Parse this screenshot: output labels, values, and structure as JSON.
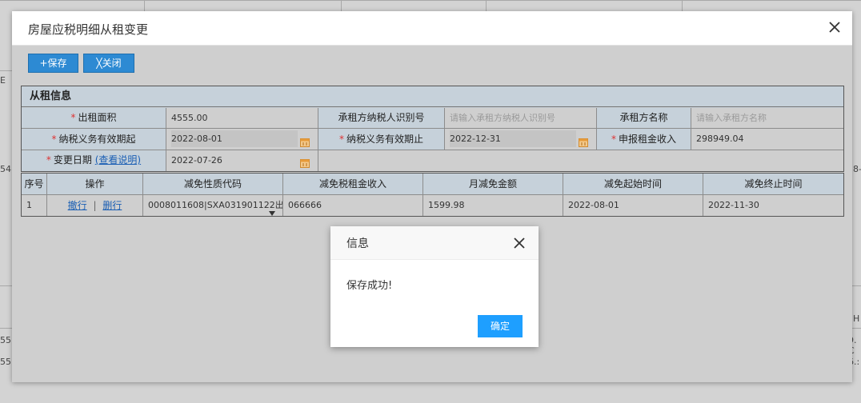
{
  "dialog": {
    "title": "房屋应税明细从租变更",
    "save_label": "+保存",
    "close_label": "╳关闭"
  },
  "section": {
    "title": "从租信息"
  },
  "form": {
    "rent_area_label": "出租面积",
    "rent_area_value": "4555.00",
    "lessee_taxid_label": "承租方纳税人识别号",
    "lessee_taxid_placeholder": "请输入承租方纳税人识别号",
    "lessee_name_label": "承租方名称",
    "lessee_name_placeholder": "请输入承租方名称",
    "tax_start_label": "纳税义务有效期起",
    "tax_start_value": "2022-08-01",
    "tax_end_label": "纳税义务有效期止",
    "tax_end_value": "2022-12-31",
    "rent_income_label": "申报租金收入",
    "rent_income_value": "298949.04",
    "change_date_label": "变更日期",
    "change_date_link": "(查看说明)",
    "change_date_value": "2022-07-26",
    "required_mark": "*"
  },
  "grid": {
    "headers": [
      "序号",
      "操作",
      "减免性质代码",
      "减免税租金收入",
      "月减免金额",
      "减免起始时间",
      "减免终止时间"
    ],
    "rows": [
      {
        "index": "1",
        "undo": "撤行",
        "sep": "|",
        "delete": "删行",
        "code": "0008011608|SXA031901122出",
        "income": "066666",
        "monthly": "1599.98",
        "start": "2022-08-01",
        "end": "2022-11-30"
      }
    ]
  },
  "message": {
    "title": "信息",
    "text": "保存成功!",
    "ok_label": "确定"
  },
  "background": {
    "frag1": "E",
    "frag2": "54",
    "frag3": "8-",
    "frag4": "H",
    "frag5": "55",
    "frag6": "55",
    "frag7": "9. C",
    "frag8": "6.:"
  },
  "colors": {
    "primary_button": "#2d8ad3",
    "ok_button": "#1e9fff",
    "required": "#d33333",
    "link": "#1b5fb4"
  }
}
